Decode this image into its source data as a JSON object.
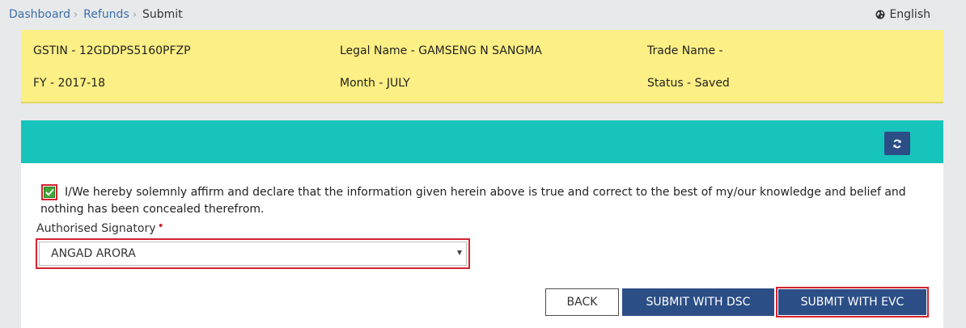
{
  "breadcrumb": {
    "items": [
      "Dashboard",
      "Refunds"
    ],
    "current": "Submit"
  },
  "language": {
    "label": "English",
    "icon": "globe-icon"
  },
  "info": {
    "gstin": "GSTIN - 12GDDPS5160PFZP",
    "legal_name": "Legal Name - GAMSENG N SANGMA",
    "trade_name": "Trade Name -",
    "fy": "FY - 2017-18",
    "month": "Month - JULY",
    "status": "Status - Saved"
  },
  "panel": {
    "refresh_icon": "refresh-icon"
  },
  "declaration": {
    "checked": true,
    "text": "I/We hereby solemnly affirm and declare that the information given herein above is true and correct to the best of my/our knowledge and belief and nothing has been concealed therefrom."
  },
  "signatory": {
    "label": "Authorised Signatory",
    "required_mark": "•",
    "selected": "ANGAD ARORA"
  },
  "buttons": {
    "back": "BACK",
    "submit_dsc": "SUBMIT WITH DSC",
    "submit_evc": "SUBMIT WITH EVC"
  },
  "colors": {
    "info_bg": "#fcef85",
    "panel_header": "#17c4bb",
    "primary": "#2c4e86",
    "highlight": "#d3232f",
    "check": "#3fa836"
  }
}
